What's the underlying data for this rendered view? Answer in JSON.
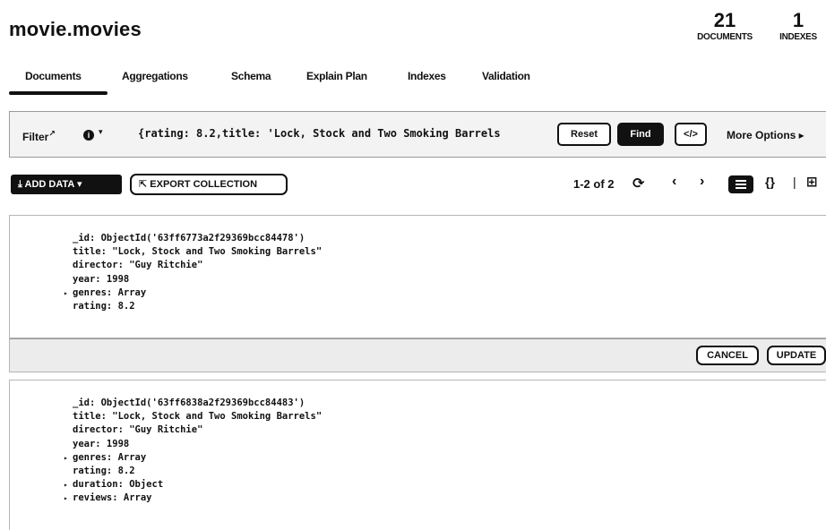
{
  "header": {
    "namespace": "movie.movies",
    "documents_count": "21",
    "documents_label": "DOCUMENTS",
    "indexes_count": "1",
    "indexes_label": "INDEXES"
  },
  "tabs": [
    {
      "label": "Documents",
      "active": true
    },
    {
      "label": "Aggregations"
    },
    {
      "label": "Schema"
    },
    {
      "label": "Explain Plan"
    },
    {
      "label": "Indexes"
    },
    {
      "label": "Validation"
    }
  ],
  "filter": {
    "label": "Filter",
    "query": "{rating: 8.2,title: 'Lock, Stock and Two Smoking Barrels",
    "reset_label": "Reset",
    "find_label": "Find",
    "code_label": "</>",
    "more_options_label": "More Options ▸"
  },
  "toolbar": {
    "add_data_label": "ADD DATA",
    "export_label": "EXPORT COLLECTION",
    "pagination": "1-2 of 2"
  },
  "documents": [
    {
      "lines": [
        "_id: ObjectId('63ff6773a2f29369bcc84478')",
        "title: \"Lock, Stock and Two Smoking Barrels\"",
        "director: \"Guy Ritchie\"",
        "year: 1998",
        "genres: Array",
        "rating: 8.2"
      ]
    },
    {
      "lines": [
        "_id: ObjectId('63ff6838a2f29369bcc84483')",
        "title: \"Lock, Stock and Two Smoking Barrels\"",
        "director: \"Guy Ritchie\"",
        "year: 1998",
        "genres: Array",
        "rating: 8.2",
        "duration: Object",
        "reviews: Array"
      ]
    }
  ],
  "edit_bar": {
    "cancel_label": "CANCEL",
    "update_label": "UPDATE"
  }
}
